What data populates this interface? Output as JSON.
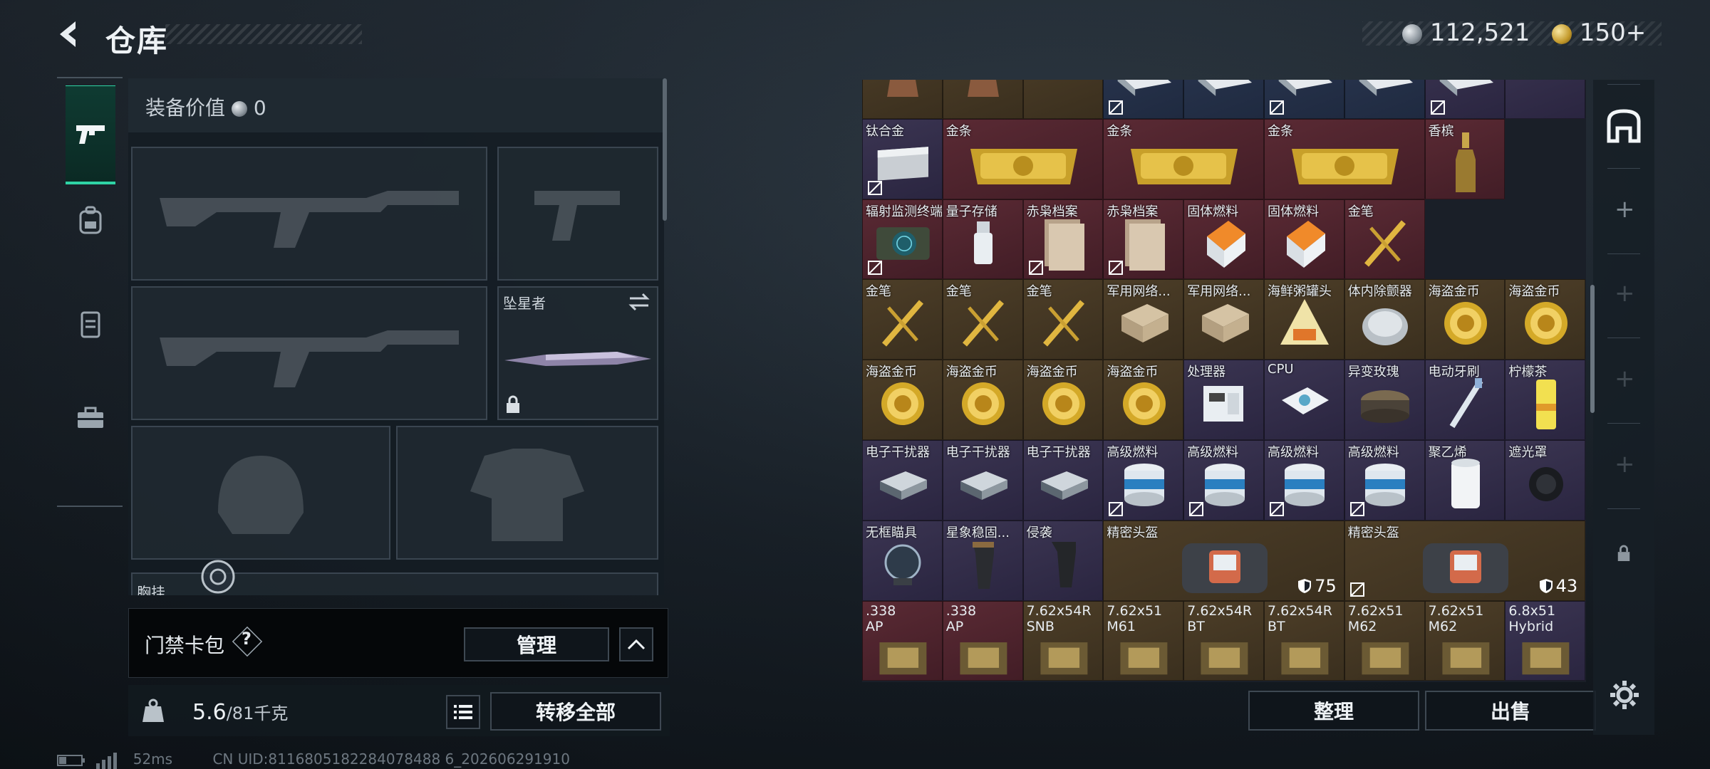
{
  "header": {
    "title": "仓库",
    "silver_amount": "112,521",
    "gold_amount": "150",
    "gold_plus": "+"
  },
  "left_tabs": [
    {
      "name": "weapon",
      "icon": "gun-icon",
      "active": true
    },
    {
      "name": "backpack",
      "icon": "backpack-icon",
      "active": false
    },
    {
      "name": "vest",
      "icon": "vest-icon",
      "active": false
    },
    {
      "name": "case",
      "icon": "briefcase-icon",
      "active": false
    }
  ],
  "equipment": {
    "value_label": "装备价值",
    "value": "0",
    "melee_name": "坠星者",
    "chest_label": "胸挂"
  },
  "cardpack": {
    "label": "门禁卡包",
    "help": "?",
    "manage": "管理"
  },
  "weight": {
    "current": "5.6",
    "max_unit": "/81千克",
    "transfer_all": "转移全部"
  },
  "status_bar": {
    "ping": "52ms",
    "uid": "CN UID:8116805182284078488 6_202606291910"
  },
  "grid": {
    "rows": [
      [
        {
          "name": "",
          "rarity": "gold",
          "icon": "tower",
          "nosell": false
        },
        {
          "name": "",
          "rarity": "gold",
          "icon": "tower",
          "nosell": false
        },
        {
          "name": "",
          "rarity": "gold",
          "icon": "",
          "nosell": false
        },
        {
          "name": "",
          "rarity": "blue",
          "icon": "device",
          "nosell": true
        },
        {
          "name": "",
          "rarity": "blue",
          "icon": "device",
          "nosell": false
        },
        {
          "name": "",
          "rarity": "blue",
          "icon": "device",
          "nosell": true
        },
        {
          "name": "",
          "rarity": "blue",
          "icon": "device",
          "nosell": false
        },
        {
          "name": "",
          "rarity": "purple",
          "icon": "device",
          "nosell": true
        },
        {
          "name": "",
          "rarity": "purple",
          "icon": "",
          "nosell": false
        }
      ],
      [
        {
          "name": "钛合金",
          "rarity": "purple",
          "icon": "ingot-silver",
          "nosell": true
        },
        {
          "name": "金条",
          "rarity": "red",
          "icon": "goldbar",
          "nosell": false,
          "span": 2
        },
        {
          "name": "金条",
          "rarity": "red",
          "icon": "goldbar",
          "nosell": false,
          "span": 2
        },
        {
          "name": "金条",
          "rarity": "red",
          "icon": "goldbar",
          "nosell": false,
          "span": 2
        },
        {
          "name": "香槟",
          "rarity": "red",
          "icon": "champagne",
          "nosell": false
        }
      ],
      [
        {
          "name": "辐射监测终端",
          "rarity": "red",
          "icon": "terminal",
          "nosell": true
        },
        {
          "name": "量子存储",
          "rarity": "red",
          "icon": "usb",
          "nosell": false
        },
        {
          "name": "赤枭档案",
          "rarity": "red",
          "icon": "files",
          "nosell": true
        },
        {
          "name": "赤枭档案",
          "rarity": "red",
          "icon": "files",
          "nosell": true
        },
        {
          "name": "固体燃料",
          "rarity": "red",
          "icon": "fuel-box",
          "nosell": false
        },
        {
          "name": "固体燃料",
          "rarity": "red",
          "icon": "fuel-box",
          "nosell": false
        },
        {
          "name": "金笔",
          "rarity": "red",
          "icon": "pen",
          "nosell": false
        }
      ],
      [
        {
          "name": "金笔",
          "rarity": "gold",
          "icon": "pen",
          "nosell": false
        },
        {
          "name": "金笔",
          "rarity": "gold",
          "icon": "pen",
          "nosell": false
        },
        {
          "name": "金笔",
          "rarity": "gold",
          "icon": "pen",
          "nosell": false
        },
        {
          "name": "军用网络...",
          "rarity": "gold",
          "icon": "module",
          "nosell": false
        },
        {
          "name": "军用网络...",
          "rarity": "gold",
          "icon": "module",
          "nosell": false
        },
        {
          "name": "海鲜粥罐头",
          "rarity": "gold",
          "icon": "can-tri",
          "nosell": false
        },
        {
          "name": "体内除颤器",
          "rarity": "gold",
          "icon": "defib",
          "nosell": false
        },
        {
          "name": "海盗金币",
          "rarity": "gold",
          "icon": "coin",
          "nosell": false
        },
        {
          "name": "海盗金币",
          "rarity": "gold",
          "icon": "coin",
          "nosell": false
        }
      ],
      [
        {
          "name": "海盗金币",
          "rarity": "gold",
          "icon": "coin",
          "nosell": false
        },
        {
          "name": "海盗金币",
          "rarity": "gold",
          "icon": "coin",
          "nosell": false
        },
        {
          "name": "海盗金币",
          "rarity": "gold",
          "icon": "coin",
          "nosell": false
        },
        {
          "name": "海盗金币",
          "rarity": "gold",
          "icon": "coin",
          "nosell": false
        },
        {
          "name": "处理器",
          "rarity": "purple",
          "icon": "processor",
          "nosell": false
        },
        {
          "name": "CPU",
          "rarity": "purple",
          "icon": "cpu",
          "nosell": false
        },
        {
          "name": "异变玫瑰",
          "rarity": "purple",
          "icon": "rose-can",
          "nosell": false
        },
        {
          "name": "电动牙刷",
          "rarity": "purple",
          "icon": "toothbrush",
          "nosell": false
        },
        {
          "name": "柠檬茶",
          "rarity": "purple",
          "icon": "lemon-tea",
          "nosell": false
        }
      ],
      [
        {
          "name": "电子干扰器",
          "rarity": "purple",
          "icon": "jammer",
          "nosell": false
        },
        {
          "name": "电子干扰器",
          "rarity": "purple",
          "icon": "jammer",
          "nosell": false
        },
        {
          "name": "电子干扰器",
          "rarity": "purple",
          "icon": "jammer",
          "nosell": false
        },
        {
          "name": "高级燃料",
          "rarity": "purple",
          "icon": "fuel-can",
          "nosell": true
        },
        {
          "name": "高级燃料",
          "rarity": "purple",
          "icon": "fuel-can",
          "nosell": true
        },
        {
          "name": "高级燃料",
          "rarity": "purple",
          "icon": "fuel-can",
          "nosell": true
        },
        {
          "name": "高级燃料",
          "rarity": "purple",
          "icon": "fuel-can",
          "nosell": true
        },
        {
          "name": "聚乙烯",
          "rarity": "purple",
          "icon": "roll",
          "nosell": false
        },
        {
          "name": "遮光罩",
          "rarity": "purple",
          "icon": "hood",
          "nosell": false
        }
      ],
      [
        {
          "name": "无框瞄具",
          "rarity": "purple",
          "icon": "scope",
          "nosell": false
        },
        {
          "name": "星象稳固...",
          "rarity": "purple",
          "icon": "grip",
          "nosell": false
        },
        {
          "name": "侵袭",
          "rarity": "purple",
          "icon": "grip2",
          "nosell": false
        },
        {
          "name": "精密头盔",
          "rarity": "gold",
          "icon": "helmet-bag",
          "nosell": false,
          "span": 3,
          "durability": "75"
        },
        {
          "name": "精密头盔",
          "rarity": "gold",
          "icon": "helmet-bag",
          "nosell": true,
          "span": 3,
          "durability": "43"
        }
      ],
      [
        {
          "name": ".338\nAP",
          "rarity": "red",
          "icon": "ammo-box",
          "nosell": false
        },
        {
          "name": ".338\nAP",
          "rarity": "red",
          "icon": "ammo-box",
          "nosell": false
        },
        {
          "name": "7.62x54R\nSNB",
          "rarity": "gold",
          "icon": "ammo-box",
          "nosell": false
        },
        {
          "name": "7.62x51\nM61",
          "rarity": "gold",
          "icon": "ammo-box",
          "nosell": false
        },
        {
          "name": "7.62x54R\nBT",
          "rarity": "gold",
          "icon": "ammo-box",
          "nosell": false
        },
        {
          "name": "7.62x54R\nBT",
          "rarity": "gold",
          "icon": "ammo-box",
          "nosell": false
        },
        {
          "name": "7.62x51\nM62",
          "rarity": "gold",
          "icon": "ammo-box",
          "nosell": false
        },
        {
          "name": "7.62x51\nM62",
          "rarity": "gold",
          "icon": "ammo-box",
          "nosell": false
        },
        {
          "name": "6.8x51\nHybrid",
          "rarity": "purple",
          "icon": "ammo-box",
          "nosell": false
        }
      ]
    ]
  },
  "grid_actions": {
    "organize": "整理",
    "sell": "出售"
  },
  "colors": {
    "accent": "#2fd3a5",
    "gold_rarity": "#4d3e28",
    "red_rarity": "#5a2a34",
    "purple_rarity": "#3b3552"
  }
}
